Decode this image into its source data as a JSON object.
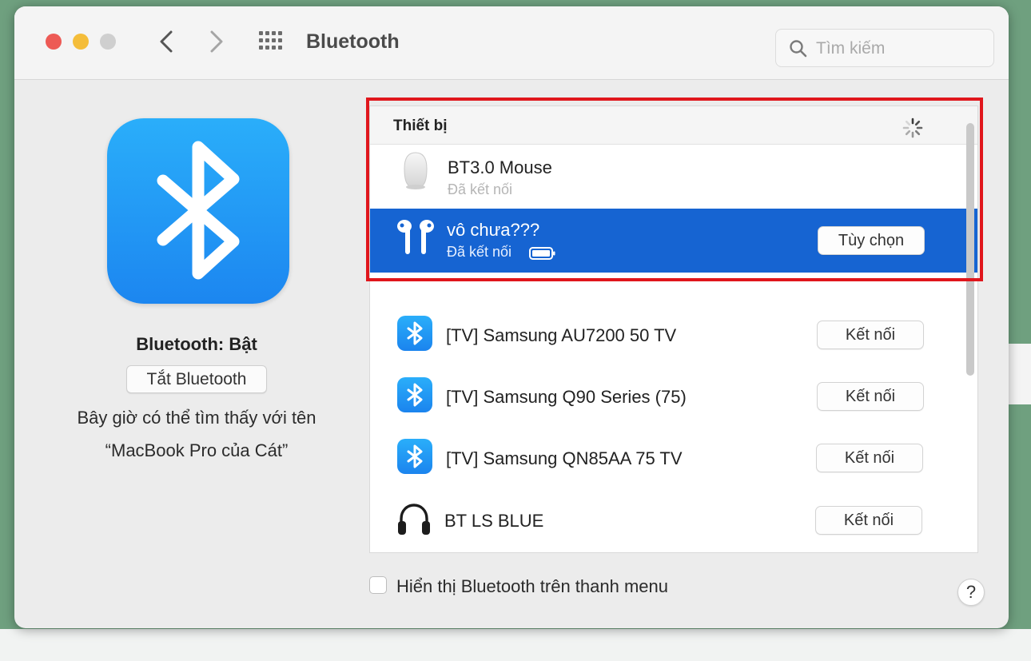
{
  "window": {
    "title": "Bluetooth",
    "search": {
      "placeholder": "Tìm kiếm",
      "value": ""
    }
  },
  "left_panel": {
    "status": "Bluetooth: Bật",
    "toggle_label": "Tắt Bluetooth",
    "discoverable_line1": "Bây giờ có thể tìm thấy với tên",
    "discoverable_line2": "“MacBook Pro của Cát”"
  },
  "devices": {
    "header": "Thiết bị",
    "connected": [
      {
        "name": "BT3.0 Mouse",
        "status": "Đã kết nối",
        "icon": "mouse-icon",
        "selected": false
      },
      {
        "name": "vô chưa???",
        "status": "Đã kết nối",
        "icon": "airpods-icon",
        "selected": true,
        "button": "Tùy chọn",
        "battery_icon": "battery-icon"
      }
    ],
    "available": [
      {
        "name": "[TV] Samsung AU7200 50 TV",
        "icon": "bluetooth-icon",
        "button": "Kết nối"
      },
      {
        "name": "[TV] Samsung Q90 Series (75)",
        "icon": "bluetooth-icon",
        "button": "Kết nối"
      },
      {
        "name": "[TV] Samsung QN85AA 75 TV",
        "icon": "bluetooth-icon",
        "button": "Kết nối"
      },
      {
        "name": "BT LS BLUE",
        "icon": "headphones-icon",
        "button": "Kết nối"
      }
    ]
  },
  "footer": {
    "menu_checkbox_label": "Hiển thị Bluetooth trên thanh menu",
    "menu_checkbox_checked": false,
    "help_label": "?"
  },
  "colors": {
    "selection": "#1664d2",
    "highlight_box": "#e0161c",
    "bluetooth_blue": "#1c86f0"
  }
}
